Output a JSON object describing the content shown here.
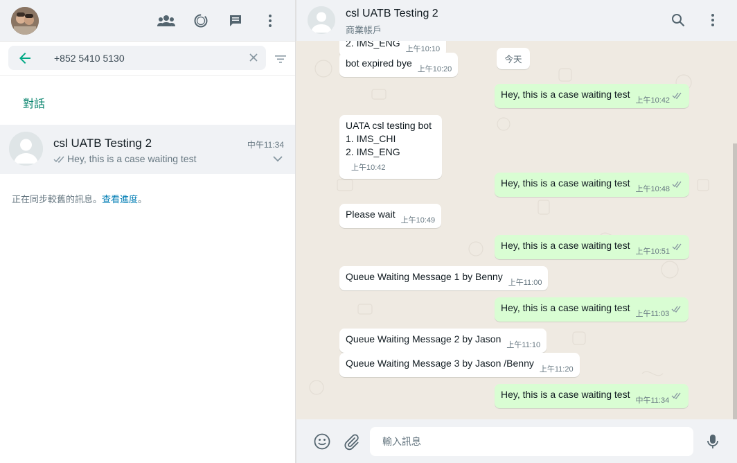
{
  "left_panel": {
    "header": {
      "icons": [
        "communities-icon",
        "status-icon",
        "new-chat-icon",
        "menu-icon"
      ]
    },
    "search": {
      "value": "+852 5410 5130"
    },
    "section_title": "對話",
    "chat": {
      "name": "csl UATB Testing 2",
      "time": "中午11:34",
      "preview": "Hey, this is a case waiting test"
    },
    "sync": {
      "text": "正在同步較舊的訊息。",
      "link": "查看進度",
      "suffix": "。"
    }
  },
  "conversation": {
    "contact_name": "csl UATB Testing 2",
    "contact_sub": "商業帳戶",
    "today_label": "今天",
    "partial_top": {
      "text": "2. IMS_ENG",
      "time": "上午10:10"
    },
    "messages": [
      {
        "dir": "in",
        "text": "bot expired bye",
        "time": "上午10:20"
      },
      {
        "dir": "out",
        "text": "Hey, this is a case waiting test",
        "time": "上午10:42"
      },
      {
        "dir": "in",
        "lines": [
          "UATA csl testing bot",
          "1. IMS_CHI",
          "2. IMS_ENG"
        ],
        "time": "上午10:42"
      },
      {
        "dir": "out",
        "text": "Hey, this is a case waiting test",
        "time": "上午10:48"
      },
      {
        "dir": "in",
        "text": "Please wait",
        "time": "上午10:49"
      },
      {
        "dir": "out",
        "text": "Hey, this is a case waiting test",
        "time": "上午10:51"
      },
      {
        "dir": "in",
        "text": "Queue Waiting Message 1 by Benny",
        "time": "上午11:00"
      },
      {
        "dir": "out",
        "text": "Hey, this is a case waiting test",
        "time": "上午11:03"
      },
      {
        "dir": "in",
        "text": "Queue Waiting Message 2 by Jason",
        "time": "上午11:10"
      },
      {
        "dir": "in",
        "text": "Queue Waiting Message 3 by Jason /Benny",
        "time": "上午11:20"
      },
      {
        "dir": "out",
        "text": "Hey, this is a case waiting test",
        "time": "中午11:34"
      }
    ],
    "composer": {
      "placeholder": "輸入訊息"
    }
  },
  "colors": {
    "accent": "#008069",
    "incoming_bubble": "#ffffff",
    "outgoing_bubble": "#d9fdd3",
    "chat_bg": "#efeae2",
    "read_tick": "#8696a0",
    "link": "#027eb5"
  }
}
